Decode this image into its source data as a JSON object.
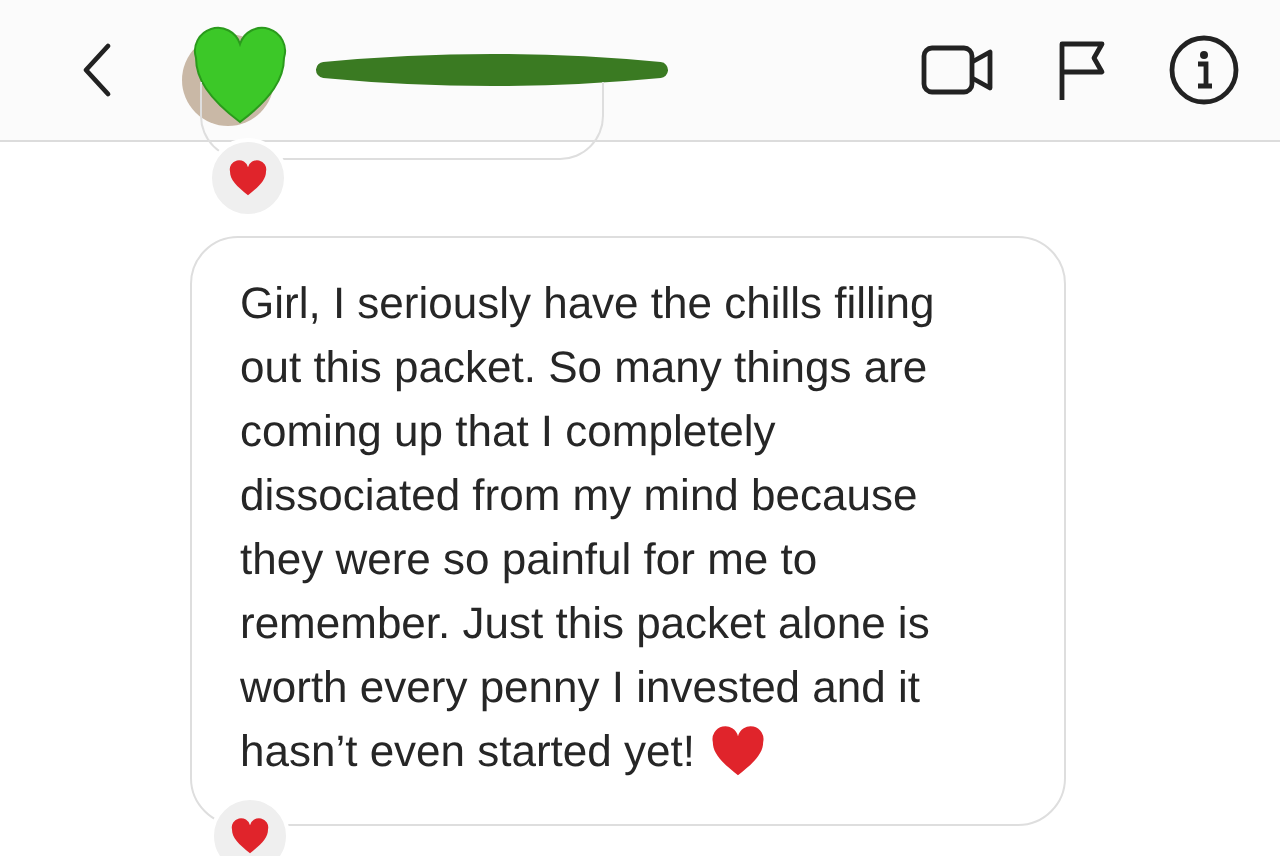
{
  "header": {
    "name_redacted": true
  },
  "messages": [
    {
      "kind": "partial",
      "reaction": true
    },
    {
      "kind": "bubble",
      "lines": [
        "Girl, I seriously have the chills filling",
        "out this packet. So many things are",
        "coming up that I completely",
        "dissociated from my mind because",
        "they were so painful for me to",
        "remember. Just this packet alone is",
        "worth every penny I invested and it",
        "hasn’t even started yet!"
      ],
      "trailing_heart": true,
      "reaction": true
    }
  ]
}
